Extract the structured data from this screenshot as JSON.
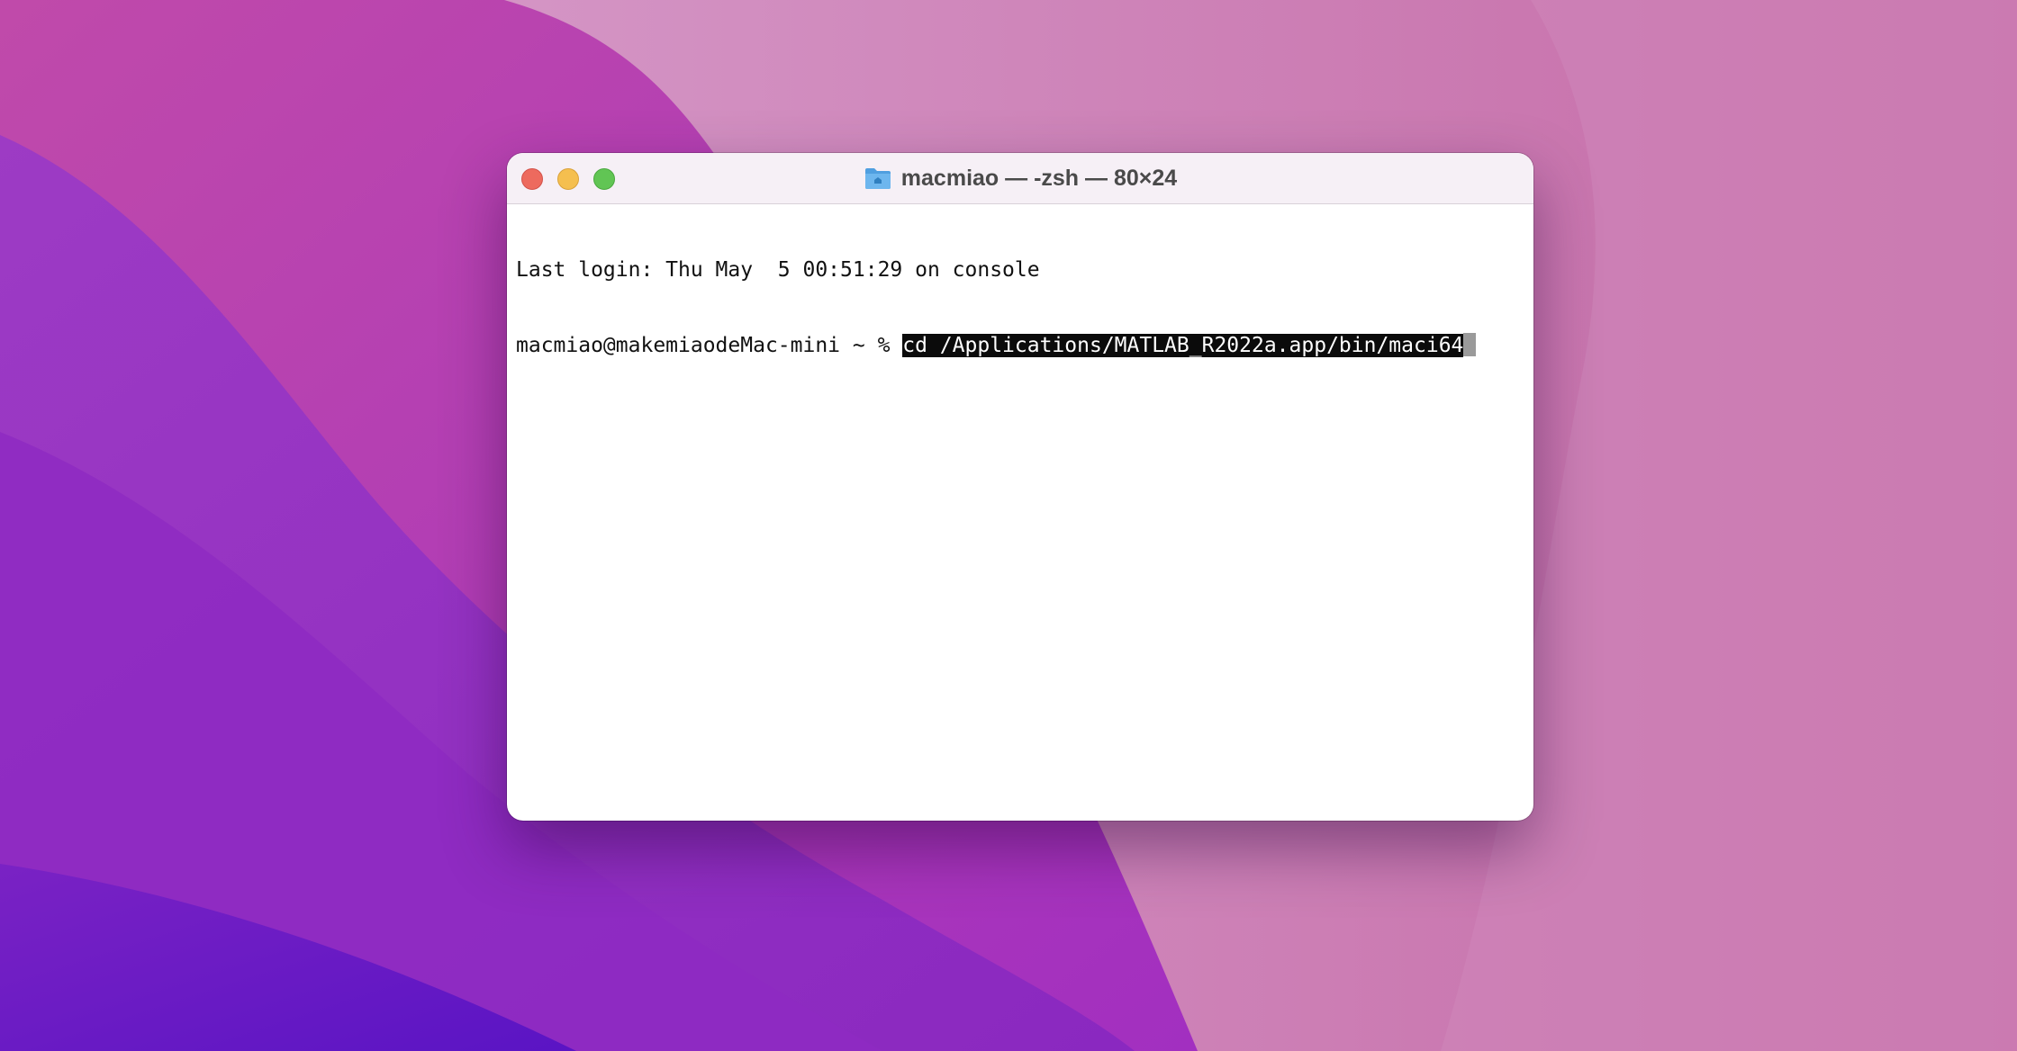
{
  "window": {
    "title": "macmiao — -zsh — 80×24",
    "folder_icon": "home-folder-icon"
  },
  "terminal": {
    "last_login": "Last login: Thu May  5 00:51:29 on console",
    "prompt": "macmiao@makemiaodeMac-mini ~ % ",
    "command": "cd /Applications/MATLAB_R2022a.app/bin/maci64"
  },
  "colors": {
    "close": "#ed6a5e",
    "minimize": "#f5bf4f",
    "zoom": "#61c554",
    "selection_bg": "#0b0b0b"
  }
}
